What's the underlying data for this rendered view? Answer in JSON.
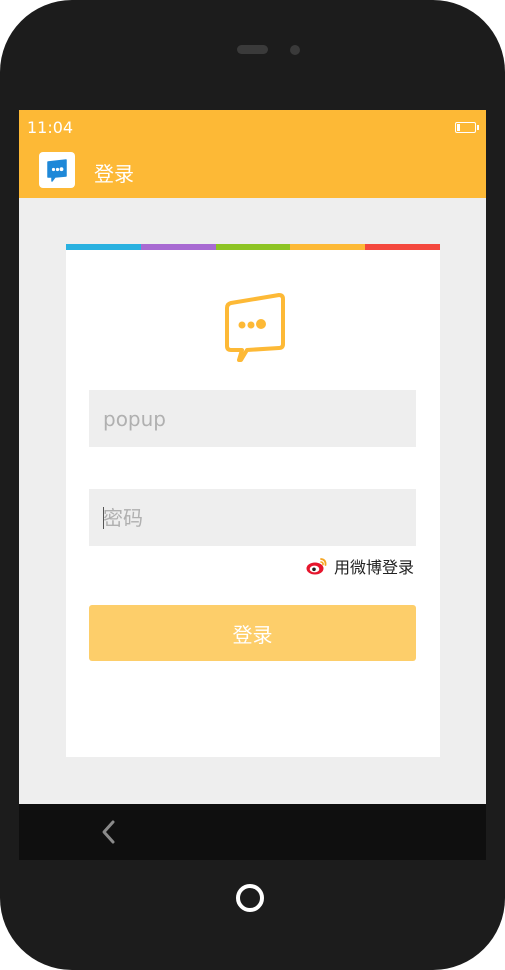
{
  "status_bar": {
    "time": "11:04"
  },
  "app_bar": {
    "title": "登录",
    "icon": "chat-bubble-icon"
  },
  "card": {
    "accent_colors": [
      "#29b1e0",
      "#a86ad2",
      "#8dc424",
      "#fdb936",
      "#f4483e"
    ],
    "logo_icon": "chat-bubble-icon",
    "username": {
      "value": "",
      "placeholder": "popup"
    },
    "password": {
      "value": "",
      "placeholder": "密码"
    },
    "weibo_login": {
      "label": "用微博登录",
      "icon": "weibo-icon"
    },
    "login_button": {
      "label": "登录"
    }
  },
  "colors": {
    "primary": "#fdb936",
    "button": "#fdce6a",
    "field_bg": "#eeeeee"
  },
  "nav": {
    "back_icon": "chevron-left-icon"
  }
}
